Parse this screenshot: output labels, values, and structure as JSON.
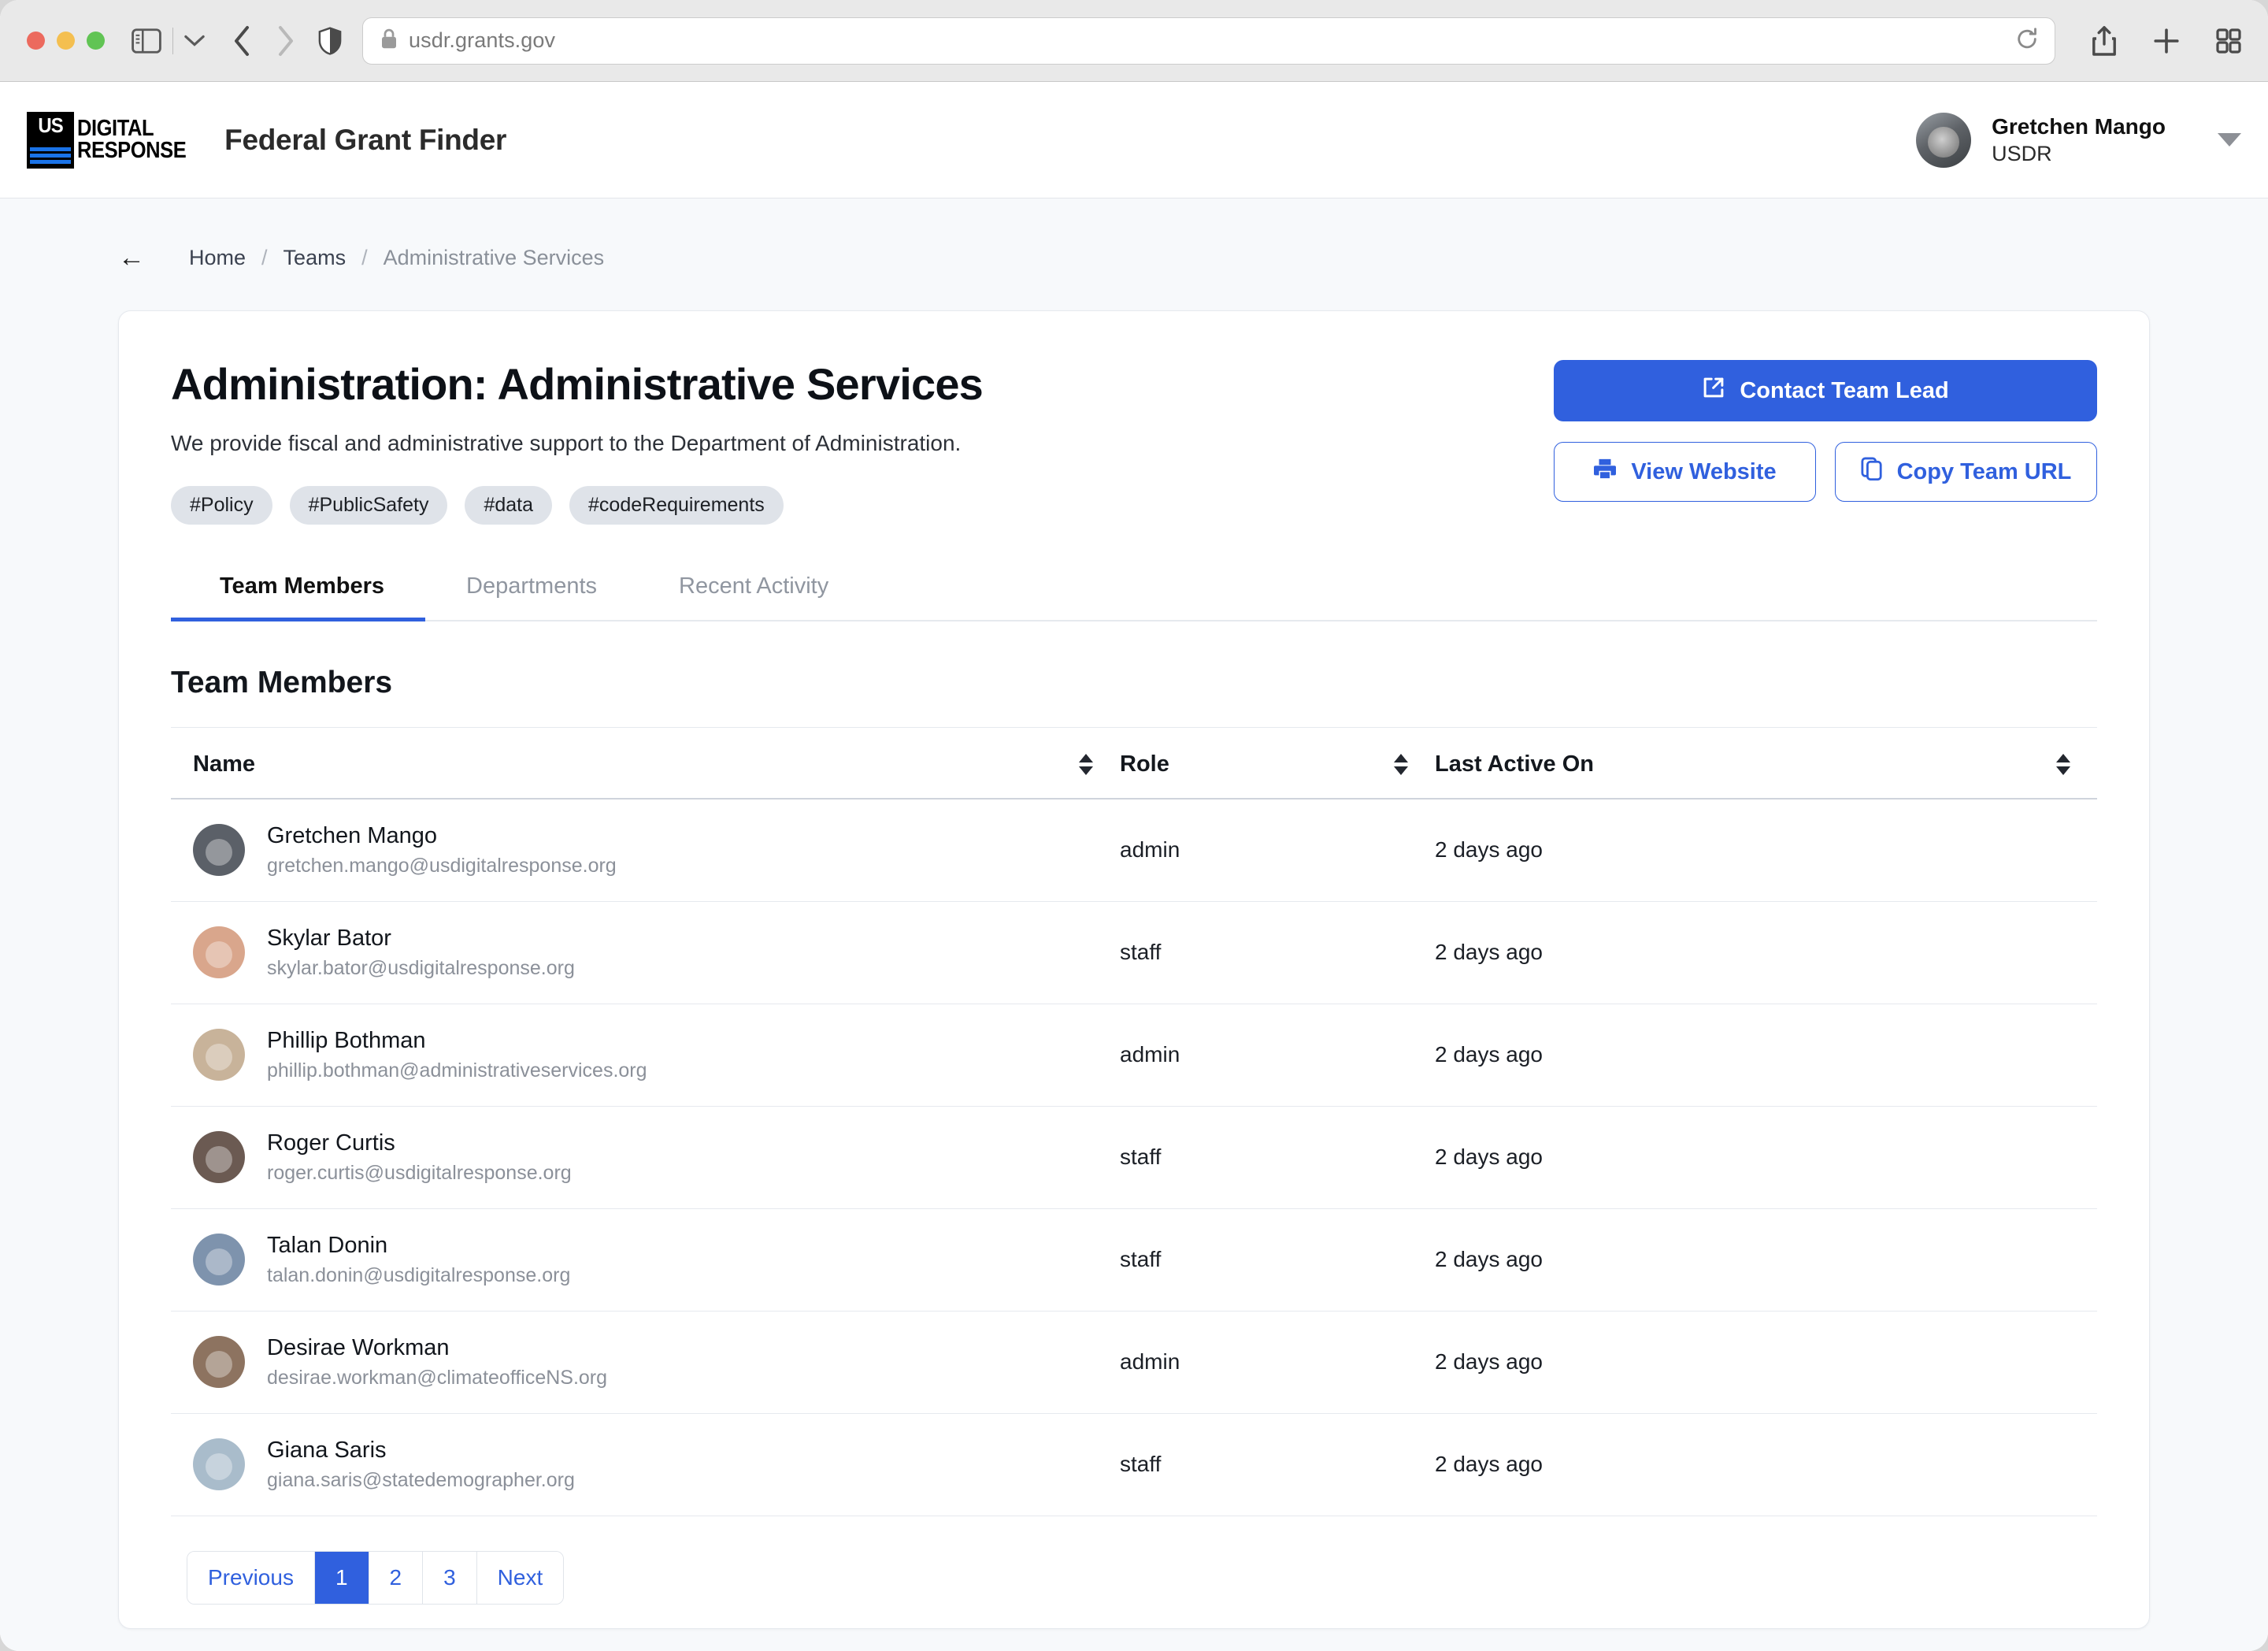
{
  "browser": {
    "url": "usdr.grants.gov",
    "lock_icon": "lock-icon",
    "sidebar_icon": "sidebar-toggle-icon",
    "back_icon": "back-chevron-icon",
    "forward_icon": "forward-chevron-icon",
    "shield_icon": "privacy-shield-icon",
    "reload_icon": "reload-icon",
    "share_icon": "share-icon",
    "new_tab_icon": "plus-icon",
    "tab_overview_icon": "tab-overview-icon"
  },
  "header": {
    "logo_us": "US",
    "logo_line1": "DIGITAL",
    "logo_line2": "RESPONSE",
    "app_title": "Federal Grant Finder",
    "user_name": "Gretchen Mango",
    "user_org": "USDR"
  },
  "breadcrumb": {
    "back": "←",
    "items": [
      {
        "label": "Home",
        "current": false
      },
      {
        "label": "Teams",
        "current": false
      },
      {
        "label": "Administrative Services",
        "current": true
      }
    ],
    "separator": "/"
  },
  "team": {
    "title": "Administration: Administrative Services",
    "description": "We provide fiscal and administrative support to the Department of Administration.",
    "tags": [
      "#Policy",
      "#PublicSafety",
      "#data",
      "#codeRequirements"
    ]
  },
  "actions": {
    "contact": "Contact Team Lead",
    "view_website": "View Website",
    "copy_url": "Copy Team URL"
  },
  "tabs": [
    {
      "label": "Team Members",
      "active": true
    },
    {
      "label": "Departments",
      "active": false
    },
    {
      "label": "Recent Activity",
      "active": false
    }
  ],
  "table": {
    "section_title": "Team Members",
    "columns": [
      {
        "label": "Name",
        "sortable": true
      },
      {
        "label": "Role",
        "sortable": true
      },
      {
        "label": "Last Active On",
        "sortable": true
      }
    ],
    "rows": [
      {
        "name": "Gretchen Mango",
        "email": "gretchen.mango@usdigitalresponse.org",
        "role": "admin",
        "last_active": "2 days ago",
        "avatar": "#5b6068"
      },
      {
        "name": "Skylar Bator",
        "email": "skylar.bator@usdigitalresponse.org",
        "role": "staff",
        "last_active": "2 days ago",
        "avatar": "#d9a68c"
      },
      {
        "name": "Phillip Bothman",
        "email": "phillip.bothman@administrativeservices.org",
        "role": "admin",
        "last_active": "2 days ago",
        "avatar": "#c8b39a"
      },
      {
        "name": "Roger Curtis",
        "email": "roger.curtis@usdigitalresponse.org",
        "role": "staff",
        "last_active": "2 days ago",
        "avatar": "#6b5a52"
      },
      {
        "name": "Talan Donin",
        "email": "talan.donin@usdigitalresponse.org",
        "role": "staff",
        "last_active": "2 days ago",
        "avatar": "#7e93ad"
      },
      {
        "name": "Desirae Workman",
        "email": "desirae.workman@climateofficeNS.org",
        "role": "admin",
        "last_active": "2 days ago",
        "avatar": "#8d7360"
      },
      {
        "name": "Giana Saris",
        "email": "giana.saris@statedemographer.org",
        "role": "staff",
        "last_active": "2 days ago",
        "avatar": "#a9bccb"
      }
    ]
  },
  "pagination": {
    "previous": "Previous",
    "pages": [
      "1",
      "2",
      "3"
    ],
    "active_page": "1",
    "next": "Next"
  },
  "colors": {
    "accent": "#3060de",
    "page_bg": "#f7f9fb",
    "tag_bg": "#dfe3e9",
    "muted_text": "#8b9099"
  }
}
